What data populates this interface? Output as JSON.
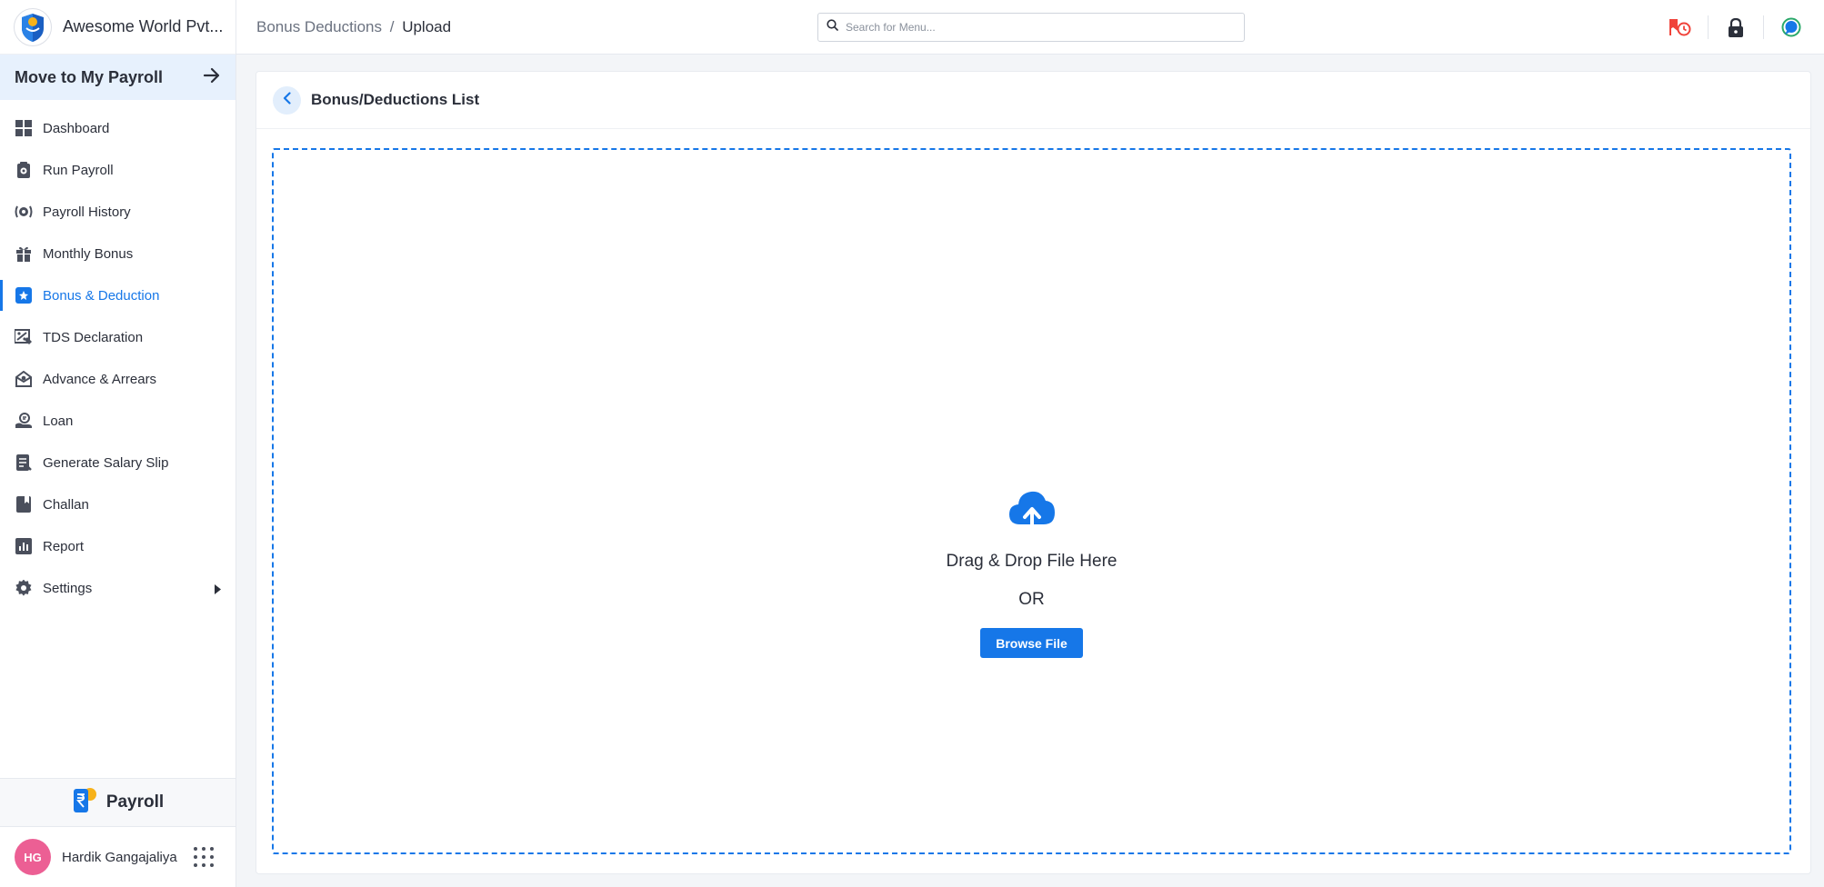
{
  "brand": {
    "name": "Awesome World Pvt..."
  },
  "move_payroll": {
    "label": "Move to My Payroll"
  },
  "sidebar": {
    "items": [
      {
        "label": "Dashboard",
        "icon": "dashboard-icon"
      },
      {
        "label": "Run Payroll",
        "icon": "run-payroll-icon"
      },
      {
        "label": "Payroll History",
        "icon": "payroll-history-icon"
      },
      {
        "label": "Monthly Bonus",
        "icon": "gift-icon"
      },
      {
        "label": "Bonus & Deduction",
        "icon": "bonus-deduction-icon",
        "active": true
      },
      {
        "label": "TDS Declaration",
        "icon": "tds-declaration-icon"
      },
      {
        "label": "Advance & Arrears",
        "icon": "advance-arrears-icon"
      },
      {
        "label": "Loan",
        "icon": "loan-icon"
      },
      {
        "label": "Generate Salary Slip",
        "icon": "salary-slip-icon"
      },
      {
        "label": "Challan",
        "icon": "challan-icon"
      },
      {
        "label": "Report",
        "icon": "report-icon"
      },
      {
        "label": "Settings",
        "icon": "gear-icon",
        "has_submenu": true
      }
    ]
  },
  "footer": {
    "product": "Payroll",
    "user": {
      "initials": "HG",
      "name": "Hardik Gangajaliya"
    }
  },
  "header": {
    "breadcrumb": {
      "parent": "Bonus Deductions",
      "separator": "/",
      "current": "Upload"
    },
    "search": {
      "placeholder": "Search for Menu..."
    },
    "icons": [
      "punch-clock-icon",
      "lock-icon",
      "chat-icon"
    ]
  },
  "page": {
    "title": "Bonus/Deductions List",
    "dropzone": {
      "text": "Drag & Drop File Here",
      "or": "OR",
      "browse_label": "Browse File"
    }
  },
  "colors": {
    "accent": "#1677e8",
    "active_bg": "#e7f1fd",
    "avatar": "#ec5f94",
    "alert": "#f0433a"
  }
}
